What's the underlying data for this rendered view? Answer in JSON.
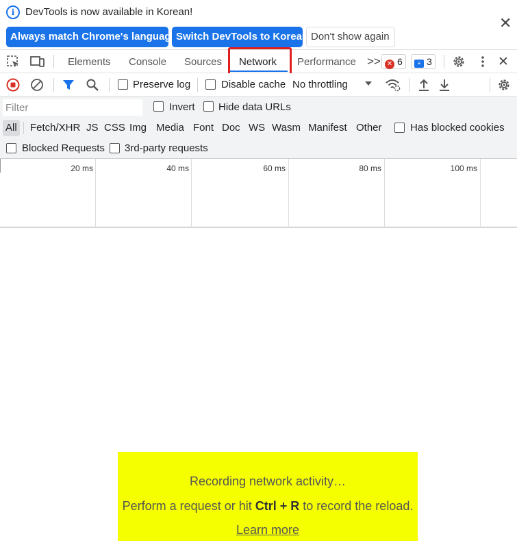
{
  "infobar": {
    "message": "DevTools is now available in Korean!",
    "buttons": {
      "always_match": "Always match Chrome's language",
      "switch": "Switch DevTools to Korean",
      "dont_show": "Don't show again"
    }
  },
  "tabs": {
    "elements": "Elements",
    "console": "Console",
    "sources": "Sources",
    "network": "Network",
    "performance": "Performance",
    "more": ">>",
    "errors_count": "6",
    "messages_count": "3",
    "active": "Network"
  },
  "toolbar": {
    "preserve_log": "Preserve log",
    "disable_cache": "Disable cache",
    "throttling": "No throttling"
  },
  "filter": {
    "placeholder": "Filter",
    "invert": "Invert",
    "hide_data_urls": "Hide data URLs",
    "types": {
      "all": "All",
      "fetch_xhr": "Fetch/XHR",
      "js": "JS",
      "css": "CSS",
      "img": "Img",
      "media": "Media",
      "font": "Font",
      "doc": "Doc",
      "ws": "WS",
      "wasm": "Wasm",
      "manifest": "Manifest",
      "other": "Other"
    },
    "has_blocked_cookies": "Has blocked cookies",
    "blocked_requests": "Blocked Requests",
    "third_party": "3rd-party requests"
  },
  "timeline": {
    "ticks": [
      "20 ms",
      "40 ms",
      "60 ms",
      "80 ms",
      "100 ms"
    ]
  },
  "empty_state": {
    "recording": "Recording network activity…",
    "perform_prefix": "Perform a request or hit ",
    "shortcut": "Ctrl + R",
    "perform_suffix": " to record the reload.",
    "learn_more": "Learn more"
  },
  "colors": {
    "accent": "#1a73e8",
    "record": "#d93025",
    "highlight_box": "#e01e1e",
    "empty_state_bg": "#f5ff00"
  }
}
